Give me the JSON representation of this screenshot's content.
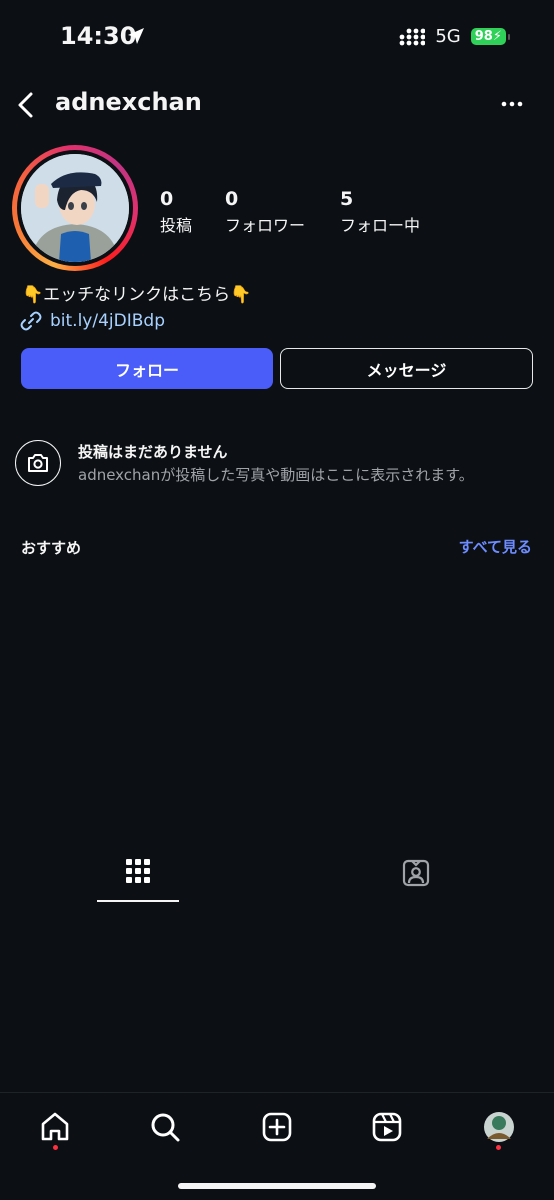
{
  "status_bar": {
    "time": "14:30",
    "network": "5G",
    "battery": "98"
  },
  "header": {
    "username": "adnexchan",
    "back_icon": "chevron-left-icon",
    "more_icon": "more-horizontal-icon"
  },
  "profile": {
    "stats": [
      {
        "value": "0",
        "label": "投稿"
      },
      {
        "value": "0",
        "label": "フォロワー"
      },
      {
        "value": "5",
        "label": "フォロー中"
      }
    ],
    "bio": "👇エッチなリンクはこちら👇",
    "link": "bit.ly/4jDIBdp"
  },
  "actions": {
    "follow": "フォロー",
    "message": "メッセージ"
  },
  "empty_state": {
    "title": "投稿はまだありません",
    "subtitle": "adnexchanが投稿した写真や動画はここに表示されます。"
  },
  "suggestions": {
    "title": "おすすめ",
    "see_all": "すべて見る"
  },
  "colors": {
    "background": "#0c1014",
    "follow_button": "#4a5df9",
    "link": "#a8d1ff",
    "see_all": "#6e8cff",
    "notification_dot": "#ff3040",
    "battery": "#30d158"
  }
}
